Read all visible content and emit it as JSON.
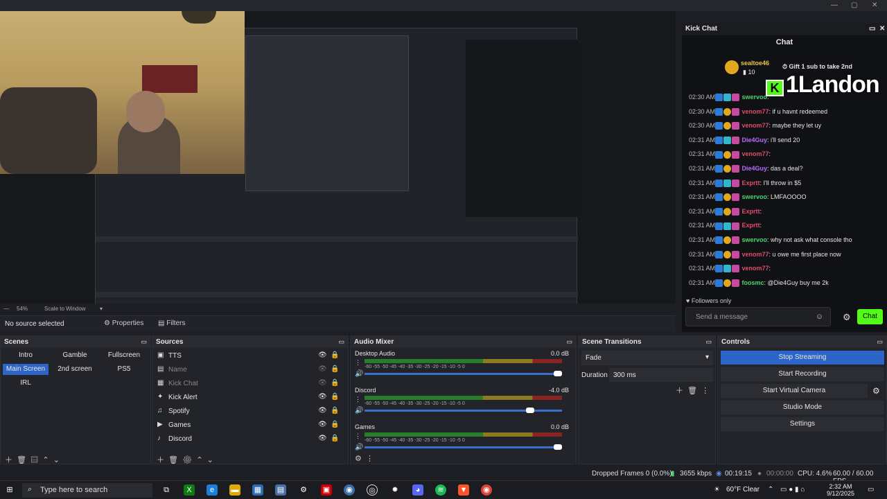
{
  "preview": {
    "zoom_label": "54%",
    "scale_label": "Scale to Window"
  },
  "source_bar": {
    "no_source": "No source selected",
    "properties": "Properties",
    "filters": "Filters"
  },
  "kick_chat": {
    "window_title": "Kick Chat",
    "chat_title": "Chat",
    "pinned_user": "sealtoe46",
    "pinned_count": "10",
    "pinned_message": "Gift 1 sub to take 2nd",
    "overlay_brand": "1Landon",
    "messages": [
      {
        "time": "02:30 AM",
        "user": "swervoo",
        "text": ":",
        "color": "#4ad66d"
      },
      {
        "time": "02:30 AM",
        "user": "venom77",
        "text": ": if u havnt redeemed",
        "color": "#e14b6a"
      },
      {
        "time": "02:30 AM",
        "user": "venom77",
        "text": ": maybe they let uy",
        "color": "#e14b6a"
      },
      {
        "time": "02:31 AM",
        "user": "Die4Guy",
        "text": ": i'll send 20",
        "color": "#b86bff"
      },
      {
        "time": "02:31 AM",
        "user": "venom77",
        "text": ":",
        "color": "#e14b6a"
      },
      {
        "time": "02:31 AM",
        "user": "Die4Guy",
        "text": ": das a deal?",
        "color": "#b86bff"
      },
      {
        "time": "02:31 AM",
        "user": "Exprtt",
        "text": ": I'll throw in $5",
        "color": "#e14b6a"
      },
      {
        "time": "02:31 AM",
        "user": "swervoo",
        "text": ": LMFAOOOO",
        "color": "#4ad66d"
      },
      {
        "time": "02:31 AM",
        "user": "Exprtt",
        "text": ":",
        "color": "#e14b6a"
      },
      {
        "time": "02:31 AM",
        "user": "Exprtt",
        "text": ":",
        "color": "#e14b6a"
      },
      {
        "time": "02:31 AM",
        "user": "swervoo",
        "text": ": why not ask what console tho",
        "color": "#4ad66d"
      },
      {
        "time": "02:31 AM",
        "user": "venom77",
        "text": ": u owe me first place now",
        "color": "#e14b6a"
      },
      {
        "time": "02:31 AM",
        "user": "venom77",
        "text": ":",
        "color": "#e14b6a"
      },
      {
        "time": "02:31 AM",
        "user": "foosmc",
        "text": ": @Die4Guy buy me 2k",
        "color": "#4ad66d"
      }
    ],
    "followers_only": "Followers only",
    "send_placeholder": "Send a message",
    "chat_button": "Chat"
  },
  "scenes": {
    "title": "Scenes",
    "items": [
      "Intro",
      "Gamble",
      "Fullscreen",
      "Main Screen",
      "2nd screen",
      "PS5",
      "IRL"
    ],
    "active": "Main Screen"
  },
  "sources": {
    "title": "Sources",
    "items": [
      "TTS",
      "Name",
      "Kick Chat",
      "Kick Alert",
      "Spotify",
      "Games",
      "Discord"
    ]
  },
  "audio_mixer": {
    "title": "Audio Mixer",
    "channels": [
      {
        "name": "Desktop Audio",
        "db": "0.0 dB",
        "level": 1.0
      },
      {
        "name": "Discord",
        "db": "-4.0 dB",
        "level": 0.86
      },
      {
        "name": "Games",
        "db": "0.0 dB",
        "level": 1.0
      }
    ],
    "ticks": "-60  -55  -50  -45  -40  -35  -30  -25  -20  -15  -10   -5   0"
  },
  "scene_transitions": {
    "title": "Scene Transitions",
    "transition": "Fade",
    "duration_label": "Duration",
    "duration_value": "300 ms"
  },
  "controls": {
    "title": "Controls",
    "stop_streaming": "Stop Streaming",
    "start_recording": "Start Recording",
    "start_virtual_camera": "Start Virtual Camera",
    "studio_mode": "Studio Mode",
    "settings": "Settings"
  },
  "status_bar": {
    "dropped_frames": "Dropped Frames 0 (0.0%)",
    "bitrate": "3655 kbps",
    "stream_time": "00:19:15",
    "rec_time": "00:00:00",
    "cpu": "CPU: 4.6%",
    "fps": "60.00 / 60.00 FPS"
  },
  "taskbar": {
    "search_placeholder": "Type here to search",
    "weather": "60°F  Clear",
    "time": "2:32 AM",
    "date": "9/12/2025"
  }
}
